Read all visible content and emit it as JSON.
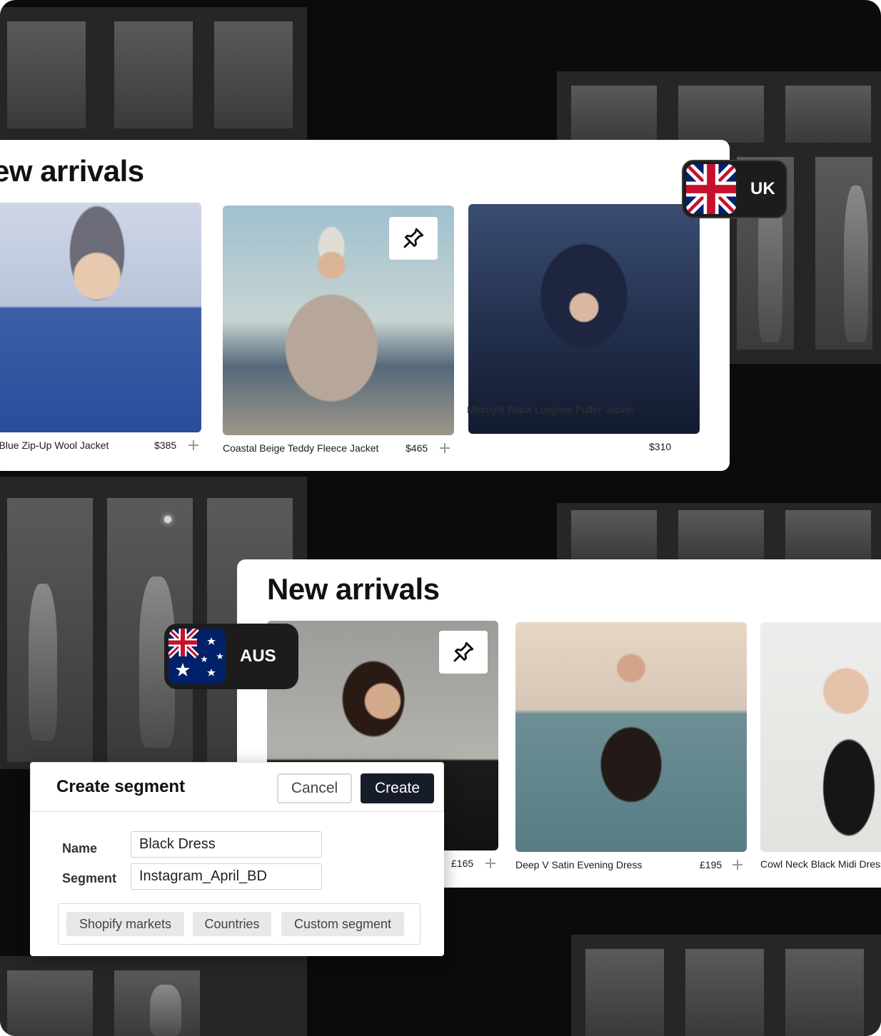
{
  "uk_panel": {
    "title": "ew arrivals",
    "region_label": "UK",
    "products": [
      {
        "name": "r Blue Zip-Up Wool Jacket",
        "price": "$385"
      },
      {
        "name": "Coastal Beige Teddy Fleece Jacket",
        "price": "$465"
      },
      {
        "name": "Midnight Black Longline Puffer Jacket",
        "price": "$310"
      }
    ]
  },
  "aus_panel": {
    "title": "New arrivals",
    "region_label": "AUS",
    "products": [
      {
        "name": "",
        "price": "£165"
      },
      {
        "name": "Deep V Satin Evening Dress",
        "price": "£195"
      },
      {
        "name": "Cowl Neck Black Midi Dress",
        "price": ""
      }
    ]
  },
  "modal": {
    "title": "Create segment",
    "cancel_label": "Cancel",
    "create_label": "Create",
    "name_label": "Name",
    "name_value": "Black Dress",
    "segment_label": "Segment",
    "segment_value": "Instagram_April_BD",
    "segment_types": [
      "Shopify markets",
      "Countries",
      "Custom segment"
    ]
  },
  "colors": {
    "dark_button": "#161c2a",
    "chip_bg": "#1c1c1c",
    "background": "#0b0b0b"
  },
  "icons": [
    "pin-icon",
    "plus-icon",
    "uk-flag-icon",
    "aus-flag-icon"
  ]
}
